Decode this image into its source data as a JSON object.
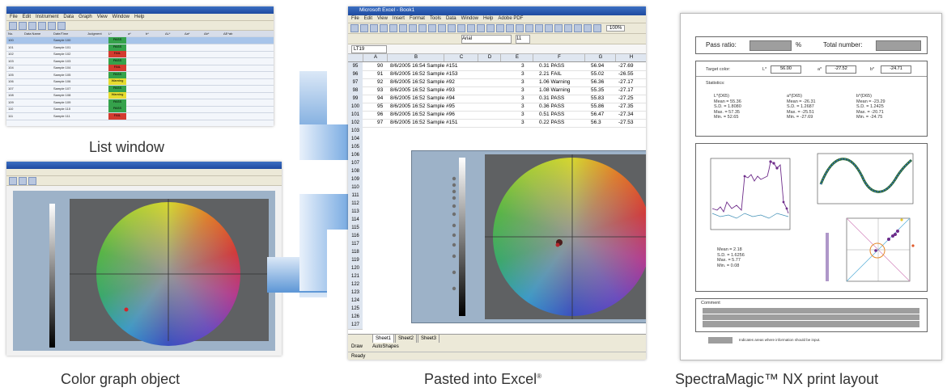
{
  "captions": {
    "list_window": "List window",
    "color_graph": "Color graph object",
    "pasted_excel": "Pasted into Excel",
    "pasted_excel_mark": "®",
    "print_layout": "SpectraMagic™ NX print layout"
  },
  "excel": {
    "title": "Microsoft Excel - Book1",
    "menu": [
      "File",
      "Edit",
      "View",
      "Insert",
      "Format",
      "Tools",
      "Data",
      "Window",
      "Help",
      "Adobe PDF"
    ],
    "font": "Arial",
    "font_size": "11",
    "zoom": "100%",
    "name_box": "LT19",
    "columns": [
      "A",
      "B",
      "C",
      "D",
      "E",
      "F",
      "G",
      "H"
    ],
    "rows": [
      {
        "n": "95",
        "a": "90",
        "b": "8/6/2005 16:54 Sample #151",
        "d": "3",
        "e": "0.31 PASS",
        "g": "56.94",
        "h": "-27.69"
      },
      {
        "n": "96",
        "a": "91",
        "b": "8/6/2005 16:52 Sample #153",
        "d": "3",
        "e": "2.21 FAIL",
        "g": "55.02",
        "h": "-26.55"
      },
      {
        "n": "97",
        "a": "92",
        "b": "8/6/2005 16:52 Sample #92",
        "d": "3",
        "e": "1.06 Warning",
        "g": "56.36",
        "h": "-27.17"
      },
      {
        "n": "98",
        "a": "93",
        "b": "8/6/2005 16:52 Sample #93",
        "d": "3",
        "e": "1.08 Warning",
        "g": "55.35",
        "h": "-27.17"
      },
      {
        "n": "99",
        "a": "94",
        "b": "8/6/2005 16:52 Sample #94",
        "d": "3",
        "e": "0.31 PASS",
        "g": "55.83",
        "h": "-27.25"
      },
      {
        "n": "100",
        "a": "95",
        "b": "8/6/2005 16:52 Sample #95",
        "d": "3",
        "e": "0.36 PASS",
        "g": "55.86",
        "h": "-27.35"
      },
      {
        "n": "101",
        "a": "96",
        "b": "8/6/2005 16:52 Sample #96",
        "d": "3",
        "e": "0.51 PASS",
        "g": "56.47",
        "h": "-27.34"
      },
      {
        "n": "102",
        "a": "97",
        "b": "8/6/2005 16:52 Sample #151",
        "d": "3",
        "e": "0.22 PASS",
        "g": "56.3",
        "h": "-27.53"
      }
    ],
    "more_rows": [
      "103",
      "104",
      "105",
      "106",
      "107",
      "108",
      "109",
      "110",
      "111",
      "112",
      "113",
      "114",
      "115",
      "116",
      "117",
      "118",
      "119",
      "120",
      "121",
      "122",
      "123",
      "124",
      "125",
      "126",
      "127",
      "128",
      "129",
      "130"
    ],
    "sheets": [
      "Sheet1",
      "Sheet2",
      "Sheet3"
    ],
    "draw_toolbar": [
      "Draw",
      "AutoShapes"
    ],
    "status": "Ready"
  },
  "print_layout": {
    "pass_ratio_label": "Pass ratio:",
    "pass_ratio_unit": "%",
    "total_number_label": "Total number:",
    "target_color_label": "Target color:",
    "l_label": "L*",
    "l_value": "56.00",
    "a_label": "a*",
    "a_value": "-27.52",
    "b_label": "b*",
    "b_value": "-24.71",
    "statistics_label": "Statistics:",
    "stats_l": "L*(D65)\nMean = 55.36\nS.D. = 1.8080\nMax. = 57.35\nMin. = 52.65",
    "stats_a": "a*(D65)\nMean = -26.31\nS.D. = 1.2687\nMax. = -25.51\nMin. = -27.69",
    "stats_b": "b*(D65)\nMean = -23.29\nS.D. = 1.2425\nMax. = -20.71\nMin. = -24.75",
    "mini_stats": "Mean = 2.18\nS.D. = 1.6256\nMax. = 5.77\nMin. = 0.08",
    "comment_label": "Comment",
    "footer_note": "Indicates areas where information should be input."
  },
  "list_window": {
    "menu": [
      "File",
      "Edit",
      "Instrument",
      "Data",
      "Graph",
      "View",
      "Window",
      "Help"
    ],
    "headers": [
      "No.",
      "Data Name",
      "Date/Time",
      "Judgment",
      "L*",
      "a*",
      "b*",
      "ΔL*",
      "Δa*",
      "Δb*",
      "ΔE*ab"
    ],
    "rows": [
      {
        "no": "100",
        "name": "Sample 100",
        "judge": "PASS",
        "c": "#35a24b"
      },
      {
        "no": "101",
        "name": "Sample 101",
        "judge": "PASS",
        "c": "#35a24b"
      },
      {
        "no": "102",
        "name": "Sample 102",
        "judge": "FAIL",
        "c": "#d33b2f"
      },
      {
        "no": "103",
        "name": "Sample 103",
        "judge": "PASS",
        "c": "#35a24b"
      },
      {
        "no": "104",
        "name": "Sample 104",
        "judge": "FAIL",
        "c": "#d33b2f"
      },
      {
        "no": "105",
        "name": "Sample 105",
        "judge": "PASS",
        "c": "#35a24b"
      },
      {
        "no": "106",
        "name": "Sample 106",
        "judge": "Warning",
        "c": "#e7dc2f"
      },
      {
        "no": "107",
        "name": "Sample 107",
        "judge": "PASS",
        "c": "#35a24b"
      },
      {
        "no": "108",
        "name": "Sample 108",
        "judge": "Warning",
        "c": "#e7dc2f"
      },
      {
        "no": "109",
        "name": "Sample 109",
        "judge": "PASS",
        "c": "#35a24b"
      },
      {
        "no": "110",
        "name": "Sample 110",
        "judge": "PASS",
        "c": "#35a24b"
      },
      {
        "no": "111",
        "name": "Sample 111",
        "judge": "FAIL",
        "c": "#d33b2f"
      }
    ]
  },
  "colors": {
    "arrow": "#1f6fc4",
    "arrow_light": "#a9c8ec",
    "plot_bg": "#9db2c8",
    "excel_header": "#dfe6f0"
  },
  "icons": [
    "arrow-right-icon",
    "color-wheel-icon",
    "lightness-bar-icon"
  ]
}
